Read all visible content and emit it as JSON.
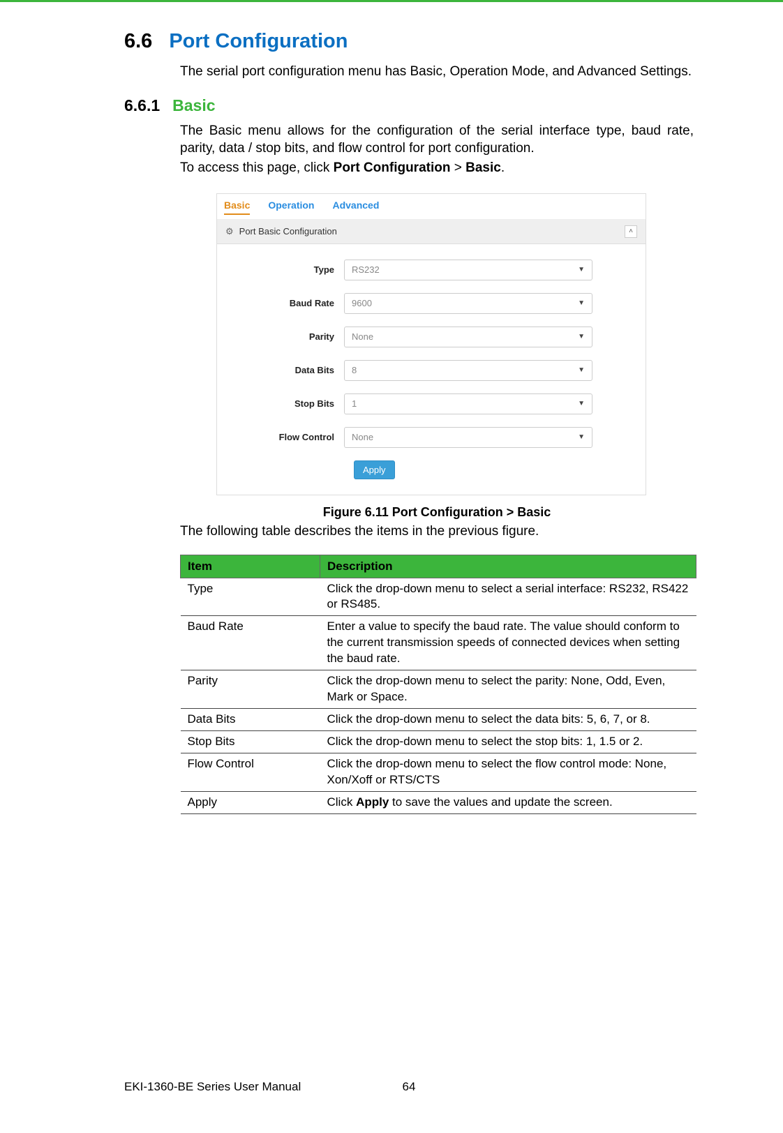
{
  "section": {
    "num": "6.6",
    "title": "Port Configuration"
  },
  "intro": "The serial port configuration menu has Basic, Operation Mode, and Advanced Settings.",
  "subsection": {
    "num": "6.6.1",
    "title": "Basic"
  },
  "sub_intro": "The Basic menu allows for the configuration of the serial interface type, baud rate, parity, data / stop bits, and flow control for port configuration.",
  "access": {
    "prefix": "To access this page, click ",
    "link1": "Port Configuration",
    "sep": " > ",
    "link2": "Basic",
    "suffix": "."
  },
  "figure": {
    "tabs": {
      "basic": "Basic",
      "operation": "Operation",
      "advanced": "Advanced"
    },
    "panel_title": "Port Basic Configuration",
    "fields": {
      "type": {
        "label": "Type",
        "value": "RS232"
      },
      "baud": {
        "label": "Baud Rate",
        "value": "9600"
      },
      "parity": {
        "label": "Parity",
        "value": "None"
      },
      "databits": {
        "label": "Data Bits",
        "value": "8"
      },
      "stopbits": {
        "label": "Stop Bits",
        "value": "1"
      },
      "flow": {
        "label": "Flow Control",
        "value": "None"
      }
    },
    "apply": "Apply",
    "caption": "Figure 6.11 Port Configuration > Basic"
  },
  "post_figure": "The following table describes the items in the previous figure.",
  "table": {
    "head": {
      "item": "Item",
      "desc": "Description"
    },
    "rows": [
      {
        "item": "Type",
        "desc": "Click the drop-down menu to select a serial interface: RS232, RS422 or RS485."
      },
      {
        "item": "Baud Rate",
        "desc": "Enter a value to specify the baud rate. The value should conform to the current transmission speeds of connected devices when setting the baud rate."
      },
      {
        "item": "Parity",
        "desc": "Click the drop-down menu to select the parity: None, Odd, Even, Mark or Space."
      },
      {
        "item": "Data Bits",
        "desc": "Click the drop-down menu to select the data bits: 5, 6, 7, or 8."
      },
      {
        "item": "Stop Bits",
        "desc": "Click the drop-down menu to select the stop bits: 1, 1.5 or 2."
      },
      {
        "item": "Flow Control",
        "desc": "Click the drop-down menu to select the flow control mode: None, Xon/Xoff or RTS/CTS"
      },
      {
        "item": "Apply",
        "desc_pre": "Click ",
        "desc_bold": "Apply",
        "desc_post": " to save the values and update the screen."
      }
    ]
  },
  "footer": {
    "left": "EKI-1360-BE Series User Manual",
    "page": "64"
  }
}
